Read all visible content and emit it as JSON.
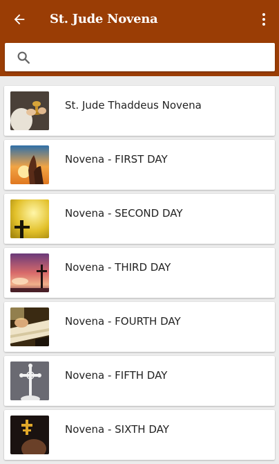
{
  "header": {
    "title": "St. Jude Novena",
    "back_icon": "arrow-left-icon",
    "menu_icon": "more-vertical-icon",
    "bar_color": "#9a3d05"
  },
  "search": {
    "icon": "search-icon",
    "placeholder": "",
    "value": ""
  },
  "list": {
    "items": [
      {
        "label": "St. Jude Thaddeus Novena",
        "thumb": "chalice-hands-image"
      },
      {
        "label": "Novena - FIRST DAY",
        "thumb": "praying-hands-sunset-image"
      },
      {
        "label": "Novena - SECOND DAY",
        "thumb": "cross-yellow-light-image"
      },
      {
        "label": "Novena - THIRD DAY",
        "thumb": "cross-sunset-sky-image"
      },
      {
        "label": "Novena - FOURTH DAY",
        "thumb": "bible-reading-image"
      },
      {
        "label": "Novena - FIFTH DAY",
        "thumb": "white-cross-statue-image"
      },
      {
        "label": "Novena - SIXTH DAY",
        "thumb": "golden-cross-dark-image"
      }
    ]
  }
}
